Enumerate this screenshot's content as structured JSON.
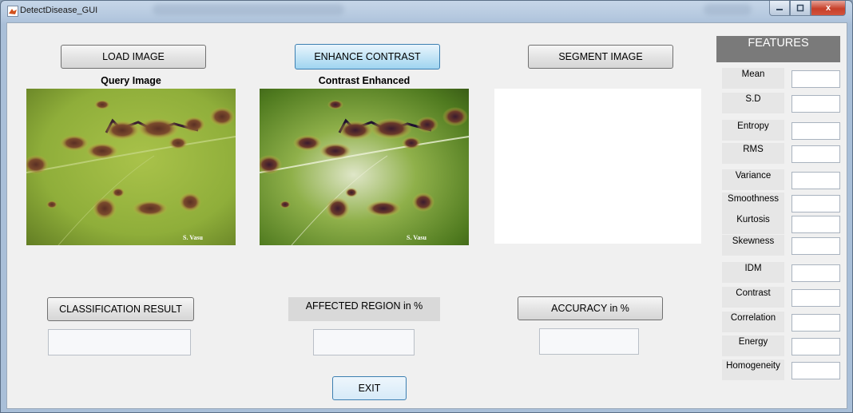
{
  "window": {
    "title": "DetectDisease_GUI",
    "close_label": "x"
  },
  "buttons": {
    "load": "LOAD IMAGE",
    "enhance": "ENHANCE CONTRAST",
    "segment": "SEGMENT IMAGE",
    "classification": "CLASSIFICATION RESULT",
    "accuracy": "ACCURACY in %",
    "exit": "EXIT"
  },
  "captions": {
    "query": "Query Image",
    "enhanced": "Contrast Enhanced"
  },
  "images": {
    "watermark": "S. Vasu"
  },
  "labels": {
    "affected": "AFFECTED REGION in %"
  },
  "outputs": {
    "classification": "",
    "affected": "",
    "accuracy": ""
  },
  "features": {
    "header": "FEATURES",
    "items": [
      {
        "label": "Mean",
        "value": ""
      },
      {
        "label": "S.D",
        "value": ""
      },
      {
        "label": "Entropy",
        "value": ""
      },
      {
        "label": "RMS",
        "value": ""
      },
      {
        "label": "Variance",
        "value": ""
      },
      {
        "label": "Smoothness",
        "value": ""
      },
      {
        "label": "Kurtosis",
        "value": ""
      },
      {
        "label": "Skewness",
        "value": ""
      },
      {
        "label": "IDM",
        "value": ""
      },
      {
        "label": "Contrast",
        "value": ""
      },
      {
        "label": "Correlation",
        "value": ""
      },
      {
        "label": "Energy",
        "value": ""
      },
      {
        "label": "Homogeneity",
        "value": ""
      }
    ]
  },
  "colors": {
    "accent": "#3c7fb1",
    "leaf_green": "#8fae3a",
    "leaf_dark": "#5f7a22",
    "lesion_brown": "#6b3a2a",
    "lesion_halo": "#d2b24a"
  }
}
